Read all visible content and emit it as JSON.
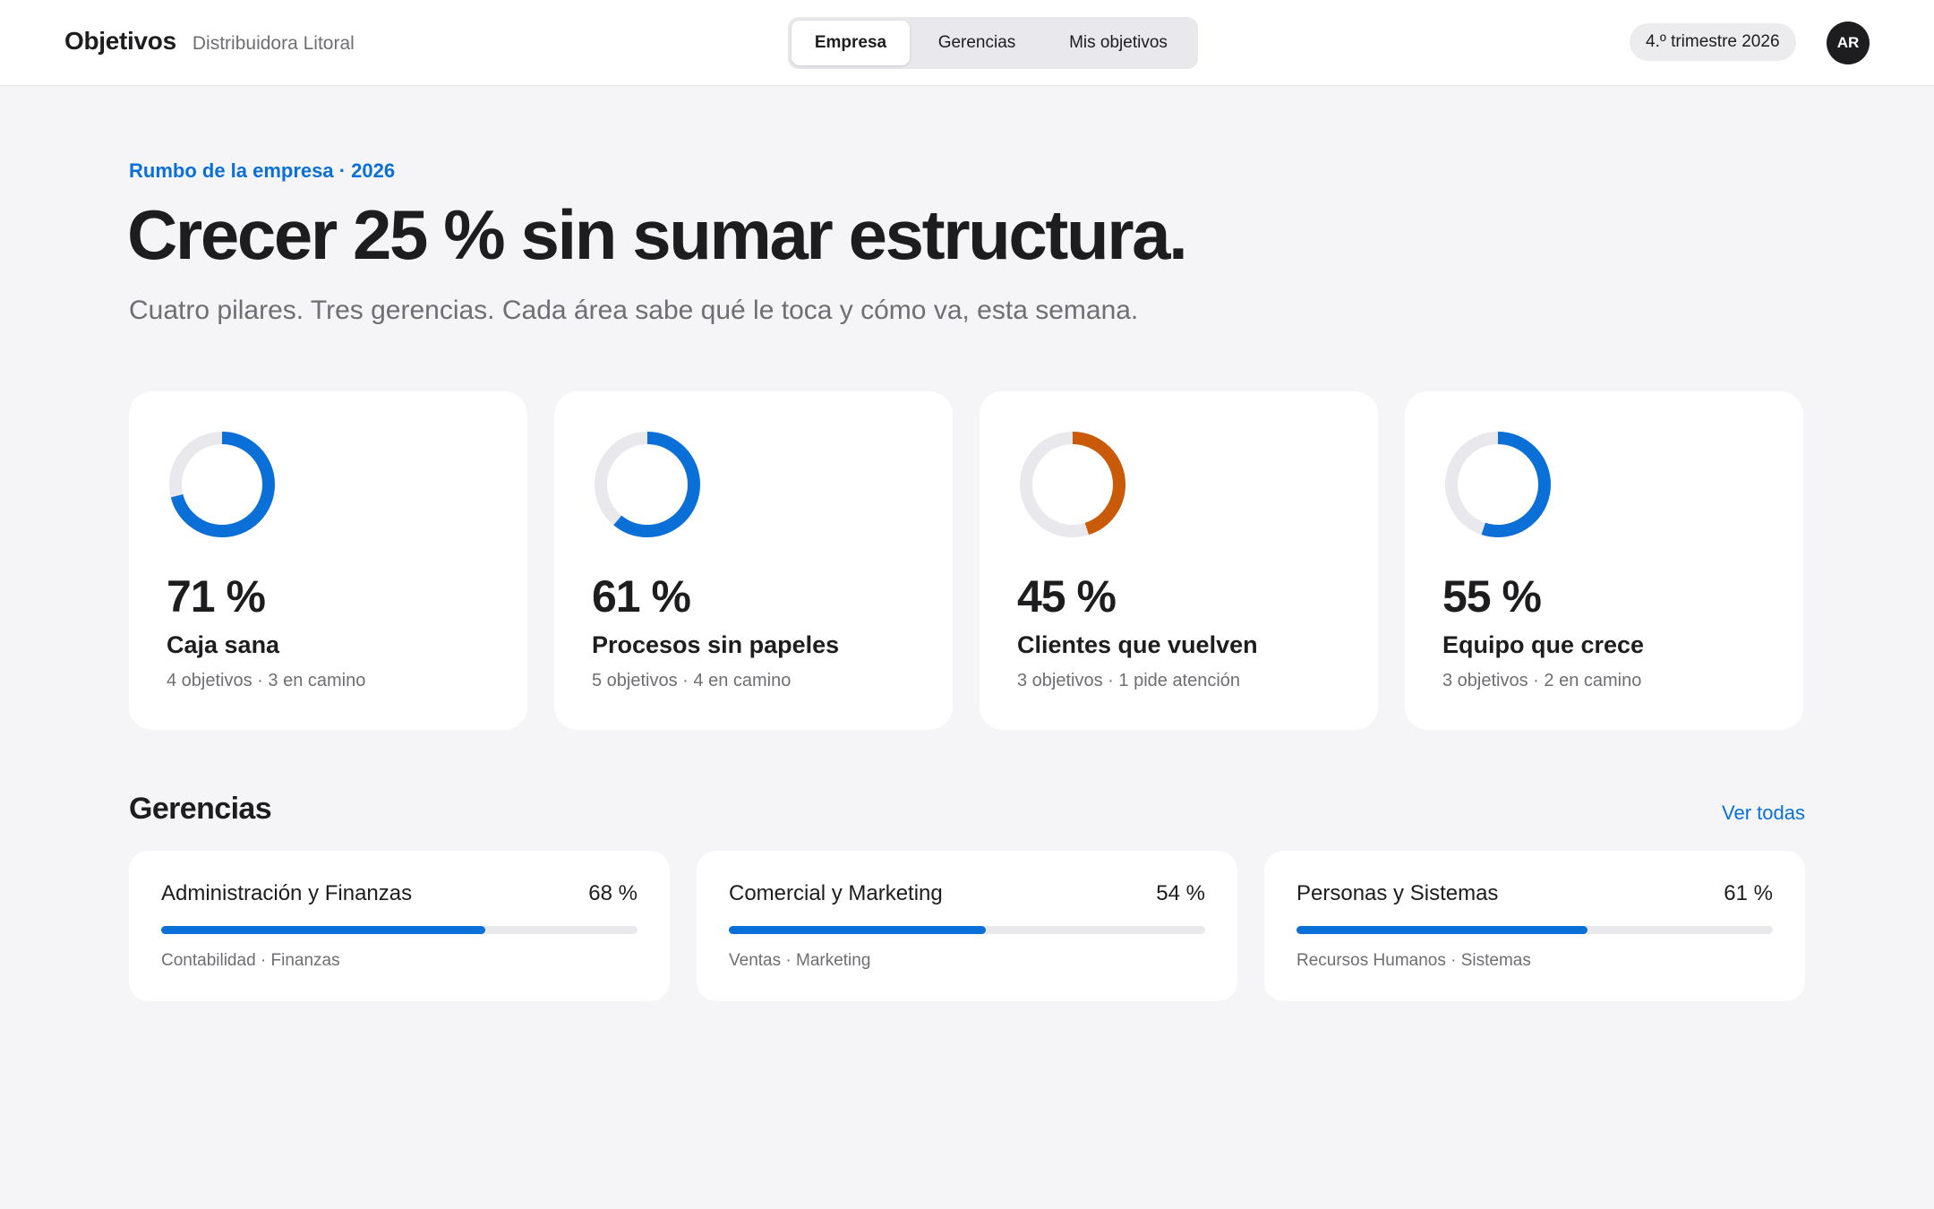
{
  "header": {
    "app_title": "Objetivos",
    "company": "Distribuidora Litoral",
    "tabs": [
      {
        "label": "Empresa",
        "active": true
      },
      {
        "label": "Gerencias",
        "active": false
      },
      {
        "label": "Mis objetivos",
        "active": false
      }
    ],
    "period": "4.º trimestre 2026",
    "user_initials": "AR"
  },
  "hero": {
    "eyebrow": "Rumbo de la empresa · 2026",
    "title": "Crecer 25 % sin sumar estructura.",
    "subtitle": "Cuatro pilares. Tres gerencias. Cada área sabe qué le toca y cómo va, esta semana."
  },
  "pillars": [
    {
      "percent_label": "71 %",
      "progress": 71,
      "name": "Caja sana",
      "meta": "4 objetivos · 3 en camino",
      "color": "#0a6fd6"
    },
    {
      "percent_label": "61 %",
      "progress": 61,
      "name": "Procesos sin papeles",
      "meta": "5 objetivos · 4 en camino",
      "color": "#0a6fd6"
    },
    {
      "percent_label": "45 %",
      "progress": 45,
      "name": "Clientes que vuelven",
      "meta": "3 objetivos · 1 pide atención",
      "color": "#c85a08"
    },
    {
      "percent_label": "55 %",
      "progress": 55,
      "name": "Equipo que crece",
      "meta": "3 objetivos · 2 en camino",
      "color": "#0a6fd6"
    }
  ],
  "managements_section": {
    "title": "Gerencias",
    "view_all": "Ver todas",
    "items": [
      {
        "name": "Administración y Finanzas",
        "percent_label": "68 %",
        "progress": 68,
        "units": "Contabilidad · Finanzas"
      },
      {
        "name": "Comercial y Marketing",
        "percent_label": "54 %",
        "progress": 54,
        "units": "Ventas · Marketing"
      },
      {
        "name": "Personas y Sistemas",
        "percent_label": "61 %",
        "progress": 61,
        "units": "Recursos Humanos · Sistemas"
      }
    ]
  },
  "colors": {
    "accent": "#0a6fd6",
    "warning": "#c85a08",
    "track": "#e8e8ed"
  }
}
